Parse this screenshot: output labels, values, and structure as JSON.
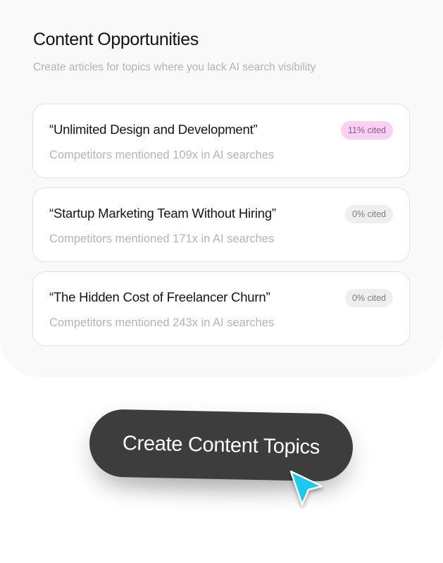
{
  "panel": {
    "title": "Content Opportunities",
    "subtitle": "Create articles for topics where you lack AI search visibility"
  },
  "opportunities": [
    {
      "title": "“Unlimited Design and Development”",
      "description": "Competitors mentioned 109x in AI searches",
      "badge": "11% cited",
      "badge_color": "#fbd0f5"
    },
    {
      "title": "“Startup Marketing Team Without Hiring”",
      "description": "Competitors mentioned 171x in AI searches",
      "badge": "0% cited",
      "badge_color": "#efefef"
    },
    {
      "title": "“The Hidden Cost of Freelancer Churn”",
      "description": "Competitors mentioned 243x in AI searches",
      "badge": "0% cited",
      "badge_color": "#efefef"
    }
  ],
  "cta": {
    "label": "Create Content Topics",
    "background": "#3d3d3d"
  },
  "cursor": {
    "icon": "pointer-cursor-icon",
    "color": "#1ec8f0"
  }
}
